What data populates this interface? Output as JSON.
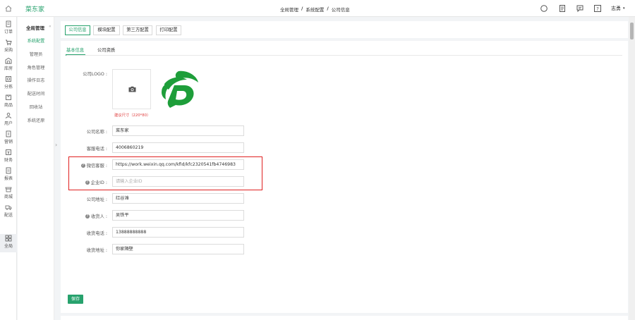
{
  "app": {
    "brand": "菜东家"
  },
  "breadcrumb": {
    "items": [
      "全局管理",
      "系统配置",
      "公司信息"
    ],
    "separator": "/"
  },
  "topbar": {
    "user": "志勇",
    "user_caret": "▾",
    "icons": [
      "compass-icon",
      "document-icon",
      "message-icon",
      "help-icon"
    ]
  },
  "left_nav": {
    "items": [
      {
        "label": "订单",
        "icon": "order-icon"
      },
      {
        "label": "采购",
        "icon": "cart-icon"
      },
      {
        "label": "库房",
        "icon": "warehouse-icon"
      },
      {
        "label": "分拣",
        "icon": "sorting-icon"
      },
      {
        "label": "商品",
        "icon": "product-icon"
      },
      {
        "label": "用户",
        "icon": "user-icon"
      },
      {
        "label": "营销",
        "icon": "marketing-icon"
      },
      {
        "label": "财务",
        "icon": "finance-icon"
      },
      {
        "label": "报表",
        "icon": "report-icon"
      },
      {
        "label": "商城",
        "icon": "mall-icon"
      },
      {
        "label": "配送",
        "icon": "delivery-icon"
      },
      {
        "label": "全局",
        "icon": "global-icon"
      }
    ],
    "active_index": 11
  },
  "sub_nav": {
    "title": "全局管理",
    "collapse_glyph": "«",
    "items": [
      "系统配置",
      "管理员",
      "角色管理",
      "操作日志",
      "配送时间",
      "回收站",
      "系统还原"
    ],
    "active_index": 0
  },
  "expand_glyph": "›",
  "tabs": {
    "items": [
      "公司信息",
      "模块配置",
      "第三方配置",
      "打印配置"
    ],
    "active_index": 0
  },
  "sub_tabs": {
    "items": [
      "基本信息",
      "公司资质"
    ],
    "active_index": 0
  },
  "form": {
    "logo_label": "公司LOGO :",
    "logo_size_hint": "建议尺寸（220*80）",
    "fields": [
      {
        "label": "公司名称 :",
        "value": "菜东家",
        "placeholder": "",
        "help": false
      },
      {
        "label": "客服电话 :",
        "value": "4006860219",
        "placeholder": "",
        "help": false
      },
      {
        "label": "微信客服 :",
        "value": "https://work.weixin.qq.com/kfid/kfc2320541fb4746983",
        "placeholder": "",
        "help": true
      },
      {
        "label": "企业ID :",
        "value": "",
        "placeholder": "请输入企业ID",
        "help": true
      },
      {
        "label": "公司地址 :",
        "value": "红谷滩",
        "placeholder": "",
        "help": false
      },
      {
        "label": "收货人 :",
        "value": "吴铁平",
        "placeholder": "",
        "help": true
      },
      {
        "label": "收货电话 :",
        "value": "13888888888",
        "placeholder": "",
        "help": false
      },
      {
        "label": "收货地址 :",
        "value": "你家隔壁",
        "placeholder": "",
        "help": false
      }
    ],
    "help_glyph": "?",
    "save_label": "保存"
  },
  "colors": {
    "accent": "#27a26d",
    "highlight_border": "#e02020",
    "hint": "#e04040"
  }
}
